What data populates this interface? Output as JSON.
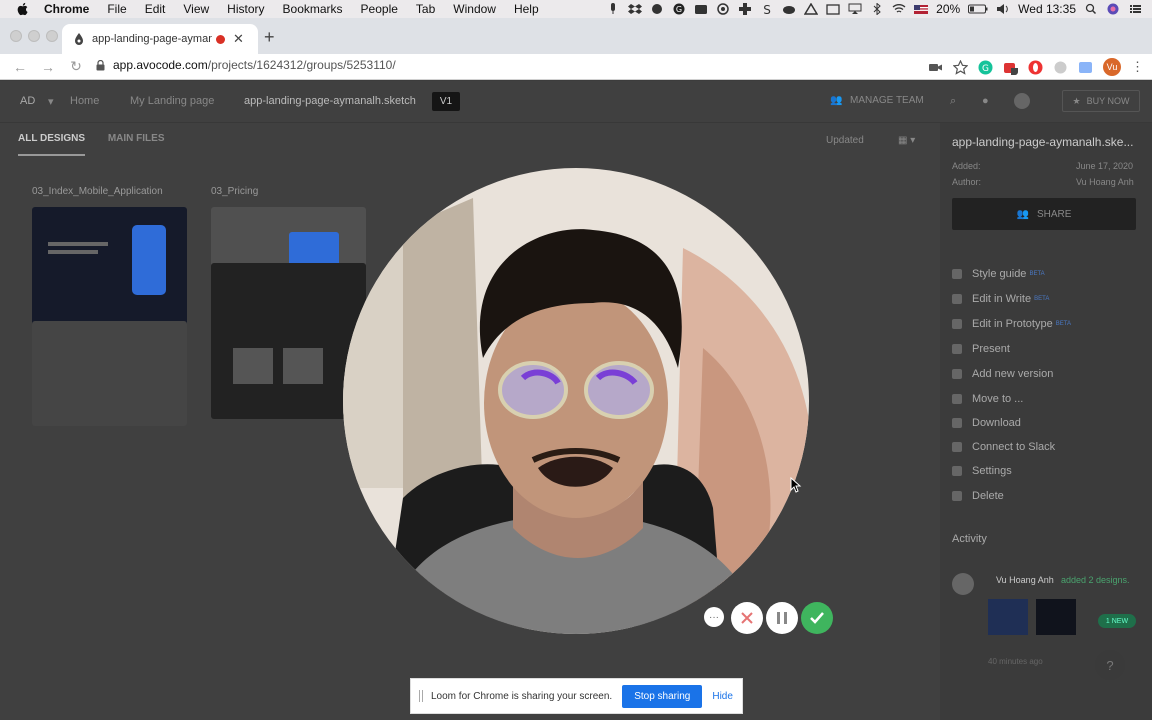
{
  "menubar": {
    "app_name": "Chrome",
    "items": [
      "File",
      "Edit",
      "View",
      "History",
      "Bookmarks",
      "People",
      "Tab",
      "Window",
      "Help"
    ],
    "battery": "20%",
    "clock": "Wed 13:35"
  },
  "browser": {
    "tab_title": "app-landing-page-aymana",
    "url_host": "app.avocode.com",
    "url_path": "/projects/1624312/groups/5253110/",
    "profile_initials": "Vu"
  },
  "app": {
    "workspace_initials": "AD",
    "breadcrumb": [
      "Home",
      "My Landing page"
    ],
    "file_name": "app-landing-page-aymanalh.sketch",
    "version_badge": "V1",
    "manage_team": "MANAGE TEAM",
    "buy_now": "BUY NOW",
    "tabs": [
      "ALL DESIGNS",
      "MAIN FILES"
    ],
    "sort_label": "Updated",
    "designs": [
      {
        "name": "03_Index_Mobile_Application"
      },
      {
        "name": "03_Pricing"
      }
    ],
    "sidebar": {
      "file_name": "app-landing-page-aymanalh.ske...",
      "added_label": "Added:",
      "added_value": "June 17, 2020",
      "author_label": "Author:",
      "author_value": "Vu Hoang Anh",
      "share": "SHARE",
      "actions": [
        {
          "label": "Style guide",
          "beta": "BETA"
        },
        {
          "label": "Edit in Write",
          "beta": "BETA"
        },
        {
          "label": "Edit in Prototype",
          "beta": "BETA"
        },
        {
          "label": "Present",
          "beta": ""
        },
        {
          "label": "Add new version",
          "beta": ""
        },
        {
          "label": "Move to ...",
          "beta": ""
        },
        {
          "label": "Download",
          "beta": ""
        },
        {
          "label": "Connect to Slack",
          "beta": ""
        },
        {
          "label": "Settings",
          "beta": ""
        },
        {
          "label": "Delete",
          "beta": ""
        }
      ],
      "activity_title": "Activity",
      "new_badge": "1 NEW",
      "activity_user": "Vu Hoang Anh",
      "activity_text": "added 2 designs.",
      "activity_time": "40 minutes ago"
    },
    "help": "?"
  },
  "loom": {
    "message": "Loom for Chrome is sharing your screen.",
    "stop_label": "Stop sharing",
    "hide_label": "Hide"
  },
  "colors": {
    "stop_button": "#1a73e8",
    "done_button": "#3fb55e",
    "cancel_icon": "#e57373"
  }
}
